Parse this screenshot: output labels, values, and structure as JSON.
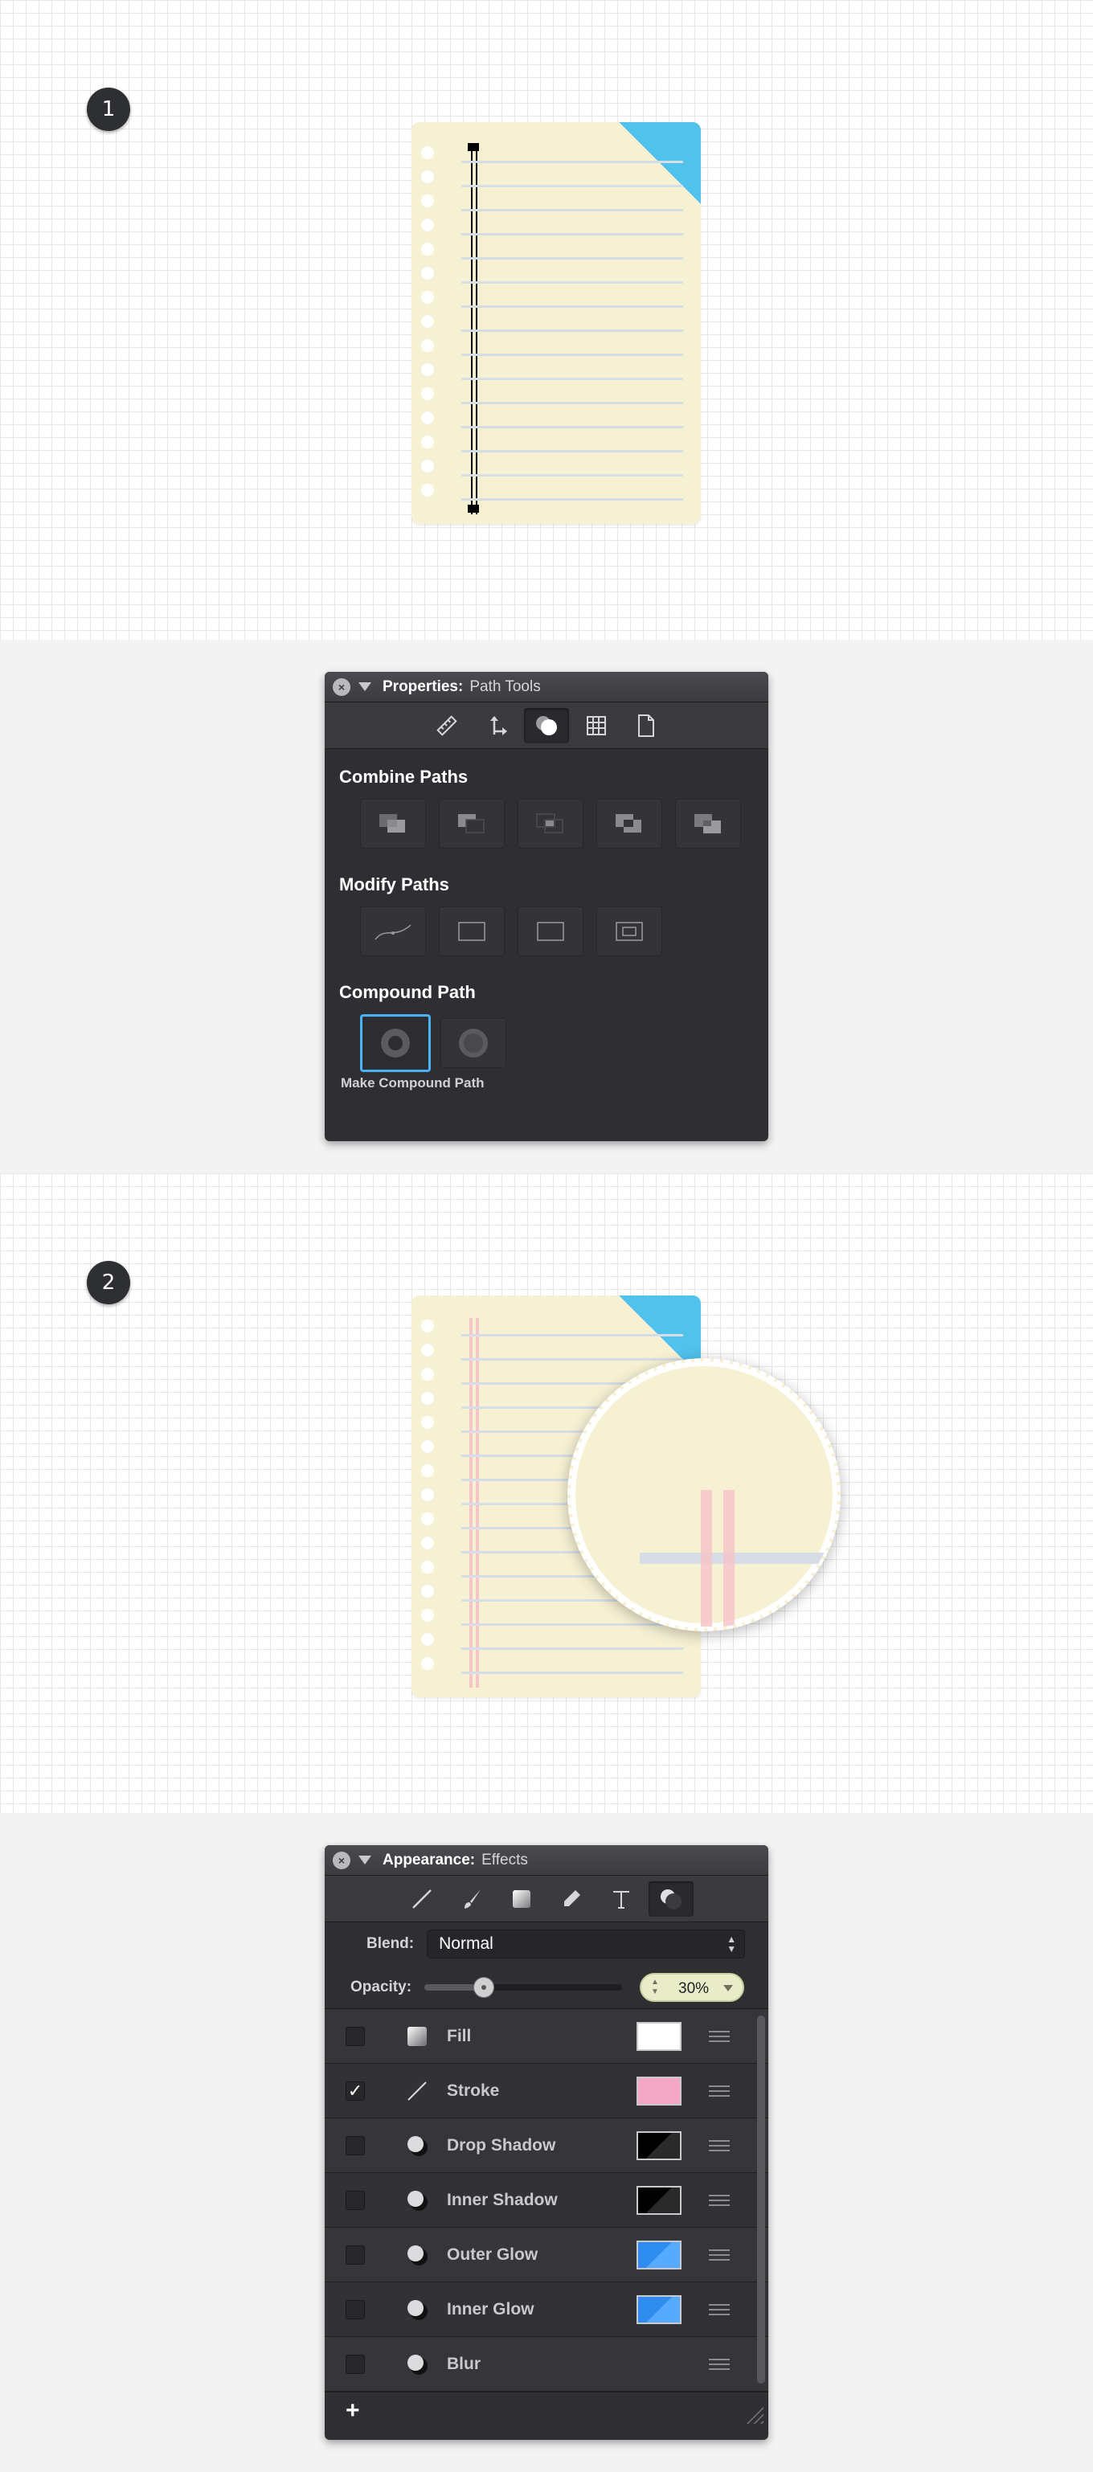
{
  "step1": {
    "badge": "1"
  },
  "properties_panel": {
    "title": "Properties:",
    "subtitle": "Path Tools",
    "close_label": "×",
    "toolbar_icons": [
      "ruler-icon",
      "transform-icon",
      "path-tools-icon",
      "grid-icon",
      "document-icon"
    ],
    "active_tool": "path-tools-icon",
    "sections": {
      "combine": {
        "title": "Combine Paths",
        "buttons": [
          "union-icon",
          "subtract-icon",
          "intersect-icon",
          "exclude-icon",
          "divide-icon"
        ]
      },
      "modify": {
        "title": "Modify Paths",
        "buttons": [
          "smooth-path-icon",
          "rectangle-icon",
          "rectangle-icon",
          "inset-rectangle-icon"
        ]
      },
      "compound": {
        "title": "Compound Path",
        "buttons": [
          "make-compound-path-icon",
          "release-compound-path-icon"
        ],
        "caption": "Make Compound Path"
      }
    }
  },
  "step2": {
    "badge": "2"
  },
  "appearance_panel": {
    "title": "Appearance:",
    "subtitle": "Effects",
    "close_label": "×",
    "toolbar_icons": [
      "line-icon",
      "brush-icon",
      "fill-icon",
      "pen-icon",
      "text-icon",
      "effects-icon"
    ],
    "active_tool": "effects-icon",
    "blend_label": "Blend:",
    "blend_value": "Normal",
    "opacity_label": "Opacity:",
    "opacity_value": "30%",
    "opacity_fraction": 0.3,
    "effects": [
      {
        "name": "Fill",
        "checked": false,
        "icon": "fill-icon",
        "swatch": "#ffffff"
      },
      {
        "name": "Stroke",
        "checked": true,
        "icon": "stroke-icon",
        "swatch": "#f5a7c6"
      },
      {
        "name": "Drop Shadow",
        "checked": false,
        "icon": "shadow-icon",
        "swatch": "#000000"
      },
      {
        "name": "Inner Shadow",
        "checked": false,
        "icon": "shadow-icon",
        "swatch": "#000000"
      },
      {
        "name": "Outer Glow",
        "checked": false,
        "icon": "glow-icon",
        "swatch": "#2f8df0"
      },
      {
        "name": "Inner Glow",
        "checked": false,
        "icon": "glow-icon",
        "swatch": "#2f8df0"
      },
      {
        "name": "Blur",
        "checked": false,
        "icon": "blur-icon",
        "swatch": null
      }
    ],
    "add_label": "+"
  },
  "colors": {
    "notepad": "#f7f1d4",
    "corner": "#50c2ec",
    "ruled_line": "#d6dde6",
    "margin_line": "#f5c4c9",
    "accent_selected": "#49b1f5"
  }
}
